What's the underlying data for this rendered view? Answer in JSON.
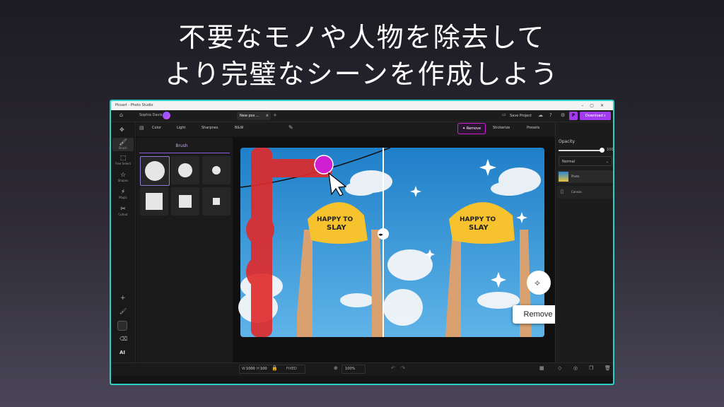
{
  "headline": {
    "line1": "不要なモノや人物を除去して",
    "line2": "より完璧なシーンを作成しよう"
  },
  "window": {
    "title": "Picsart - Photo Studio",
    "user_name": "Sophia Davis",
    "tab_label": "New pos ...",
    "tab_close": "×",
    "tab_add": "+",
    "save_label": "Save Project",
    "pro_badge": "P",
    "download_label": "Download"
  },
  "toolbar": {
    "color": "Color",
    "light": "Light",
    "sharpness": "Sharpnes",
    "bw": "B&W",
    "remove": "Remove",
    "stickers": "Stickerize",
    "presets": "Presets"
  },
  "rail": {
    "items": [
      {
        "label": "Brush",
        "icon": "brush-icon"
      },
      {
        "label": "Free Select",
        "icon": "lasso-icon"
      },
      {
        "label": "Shapes",
        "icon": "star-icon"
      },
      {
        "label": "Magic",
        "icon": "magic-wand-icon"
      },
      {
        "label": "Cutout",
        "icon": "scissors-icon"
      }
    ],
    "ai_label": "AI"
  },
  "brush_panel": {
    "title": "Brush"
  },
  "canvas": {
    "cap_text_line1": "HAPPY TO",
    "cap_text_line2": "SLAY",
    "tooltip_label": "Remove"
  },
  "right_panel": {
    "opacity_label": "Opacity",
    "opacity_value": "100",
    "blend_mode": "Normal",
    "layers": [
      {
        "name": "Photo"
      },
      {
        "name": "Canvas"
      }
    ]
  },
  "bottom_bar": {
    "w_label": "W",
    "w_value": "1000",
    "h_label": "H",
    "h_value": "100",
    "fixed_label": "FIXED",
    "zoom_value": "100%"
  },
  "colors": {
    "accent": "#a23bf0",
    "highlight": "#d01fd0",
    "frame": "#2bd0c8"
  }
}
